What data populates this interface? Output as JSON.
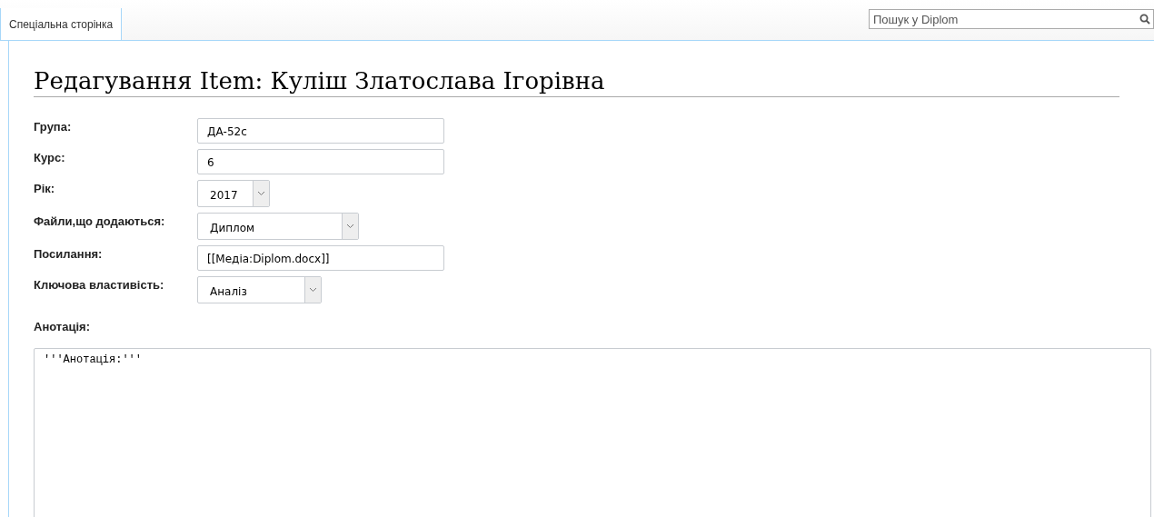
{
  "tabs": [
    {
      "label": "Спеціальна сторінка",
      "selected": true
    }
  ],
  "search": {
    "placeholder": "Пошук у Diplom"
  },
  "heading": "Редагування Item: Куліш Златослава Ігорівна",
  "form": {
    "fields": [
      {
        "label": "Група:",
        "kind": "input",
        "value": "ДА-52с"
      },
      {
        "label": "Курс:",
        "kind": "input",
        "value": "6"
      },
      {
        "label": "Рік:",
        "kind": "select",
        "value": "2017"
      },
      {
        "label": "Файли,що додаються:",
        "kind": "select",
        "value": "Диплом"
      },
      {
        "label": "Посилання:",
        "kind": "input",
        "value": "[[Медіа:Diplom.docx]]"
      },
      {
        "label": "Ключова властивість:",
        "kind": "select",
        "value": "Аналіз"
      }
    ]
  },
  "annotation": {
    "label": "Анотація:",
    "value": "'''Анотація:'''"
  }
}
